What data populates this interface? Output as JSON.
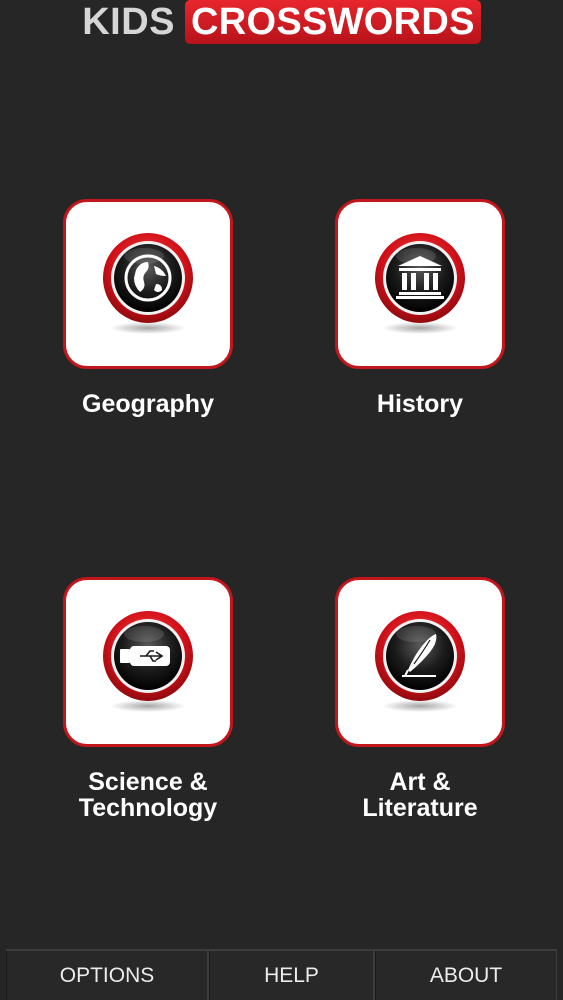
{
  "header": {
    "logo_kids": "KIDS",
    "logo_crosswords": "CROSSWORDS"
  },
  "categories": [
    {
      "label_lines": [
        "Geography"
      ],
      "icon": "globe-icon"
    },
    {
      "label_lines": [
        "History"
      ],
      "icon": "museum-icon"
    },
    {
      "label_lines": [
        "Science &",
        "Technology"
      ],
      "icon": "usb-drive-icon"
    },
    {
      "label_lines": [
        "Art &",
        "Literature"
      ],
      "icon": "quill-pen-icon"
    }
  ],
  "bottom_bar": {
    "options": "OPTIONS",
    "help": "HELP",
    "about": "ABOUT"
  },
  "colors": {
    "background": "#262626",
    "accent": "#c3161c",
    "tile": "#ffffff",
    "text": "#ffffff"
  }
}
